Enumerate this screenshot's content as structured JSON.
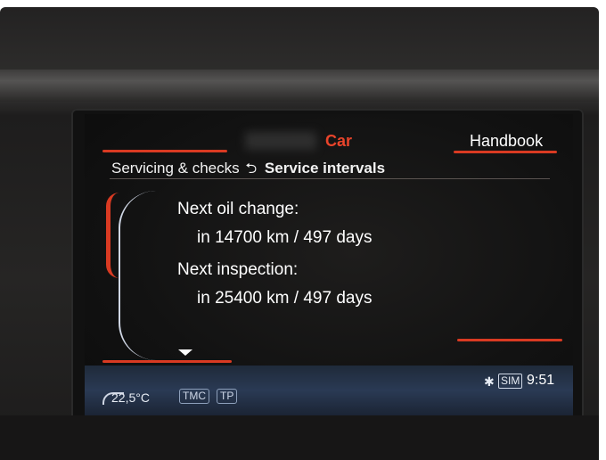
{
  "header": {
    "tab_active": "Car",
    "tab_right": "Handbook"
  },
  "breadcrumb": {
    "parent": "Servicing & checks",
    "back_symbol": "⮌",
    "current": "Service intervals"
  },
  "service": {
    "oil_label": "Next oil change:",
    "oil_value": "in 14700 km / 497 days",
    "inspection_label": "Next inspection:",
    "inspection_value": "in 25400 km / 497 days"
  },
  "status_bar": {
    "temperature": "22,5°C",
    "tmc": "TMC",
    "tp": "TP",
    "bluetooth_icon": "bluetooth-icon",
    "sim": "SIM",
    "time": "9:51"
  },
  "colors": {
    "accent": "#d93a22",
    "screen_bg": "#121212",
    "status_bg": "#2a3a54"
  }
}
